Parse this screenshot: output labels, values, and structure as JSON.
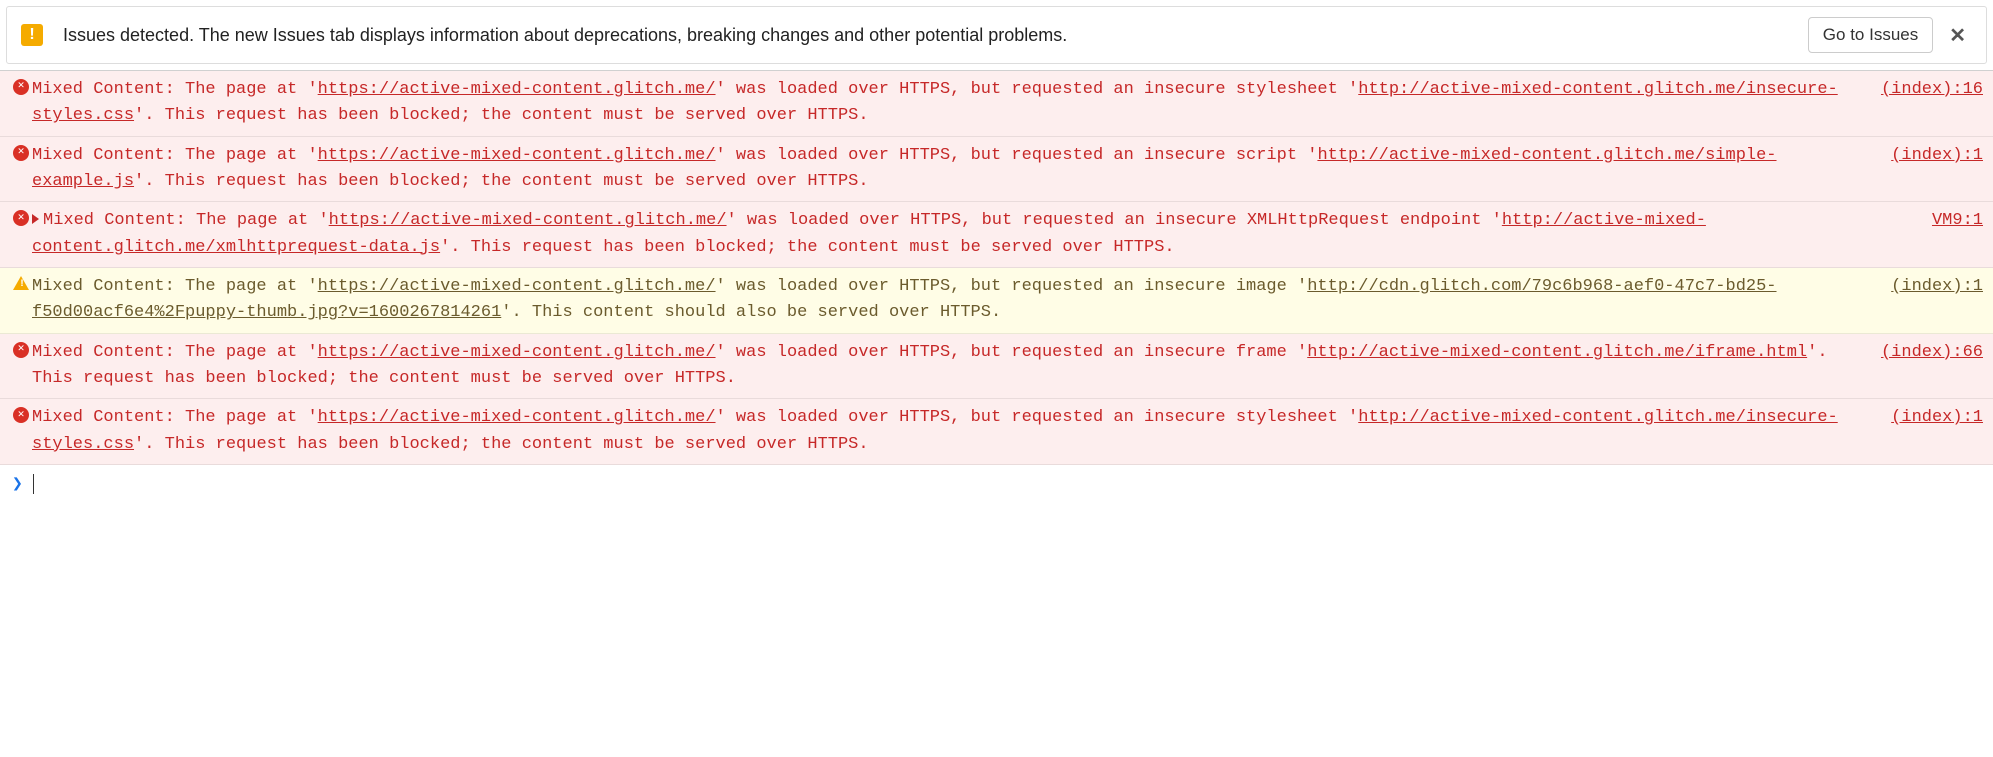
{
  "issuesBar": {
    "text": "Issues detected. The new Issues tab displays information about deprecations, breaking changes and other potential problems.",
    "button": "Go to Issues",
    "close": "✕"
  },
  "pageUrl": "https://active-mixed-content.glitch.me/",
  "messages": [
    {
      "level": "error",
      "prefix": "Mixed Content: The page at '",
      "resourceType": "stylesheet",
      "midA": "' was loaded over HTTPS, but requested an insecure ",
      "midB": " '",
      "resourceUrl": "http://active-mixed-content.glitch.me/insecure-styles.css",
      "suffix": "'. This request has been blocked; the content must be served over HTTPS.",
      "source": "(index):16",
      "expandable": false
    },
    {
      "level": "error",
      "prefix": "Mixed Content: The page at '",
      "resourceType": "script",
      "midA": "' was loaded over HTTPS, but requested an insecure ",
      "midB": " '",
      "resourceUrl": "http://active-mixed-content.glitch.me/simple-example.js",
      "suffix": "'. This request has been blocked; the content must be served over HTTPS.",
      "source": "(index):1",
      "expandable": false
    },
    {
      "level": "error",
      "prefix": "Mixed Content: The page at '",
      "resourceType": "XMLHttpRequest endpoint",
      "midA": "' was loaded over HTTPS, but requested an insecure ",
      "midB": " '",
      "resourceUrl": "http://active-mixed-content.glitch.me/xmlhttprequest-data.js",
      "suffix": "'. This request has been blocked; the content must be served over HTTPS.",
      "source": "VM9:1",
      "expandable": true
    },
    {
      "level": "warning",
      "prefix": "Mixed Content: The page at '",
      "resourceType": "image",
      "midA": "' was loaded over HTTPS, but requested an insecure ",
      "midB": " '",
      "resourceUrl": "http://cdn.glitch.com/79c6b968-aef0-47c7-bd25-f50d00acf6e4%2Fpuppy-thumb.jpg?v=1600267814261",
      "suffix": "'. This content should also be served over HTTPS.",
      "source": "(index):1",
      "expandable": false
    },
    {
      "level": "error",
      "prefix": "Mixed Content: The page at '",
      "resourceType": "frame",
      "midA": "' was loaded over HTTPS, but requested an insecure ",
      "midB": " '",
      "resourceUrl": "http://active-mixed-content.glitch.me/iframe.html",
      "suffix": "'. This request has been blocked; the content must be served over HTTPS.",
      "source": "(index):66",
      "expandable": false
    },
    {
      "level": "error",
      "prefix": "Mixed Content: The page at '",
      "resourceType": "stylesheet",
      "midA": "' was loaded over HTTPS, but requested an insecure ",
      "midB": " '",
      "resourceUrl": "http://active-mixed-content.glitch.me/insecure-styles.css",
      "suffix": "'. This request has been blocked; the content must be served over HTTPS.",
      "source": "(index):1",
      "expandable": false
    }
  ],
  "prompt": "❯"
}
